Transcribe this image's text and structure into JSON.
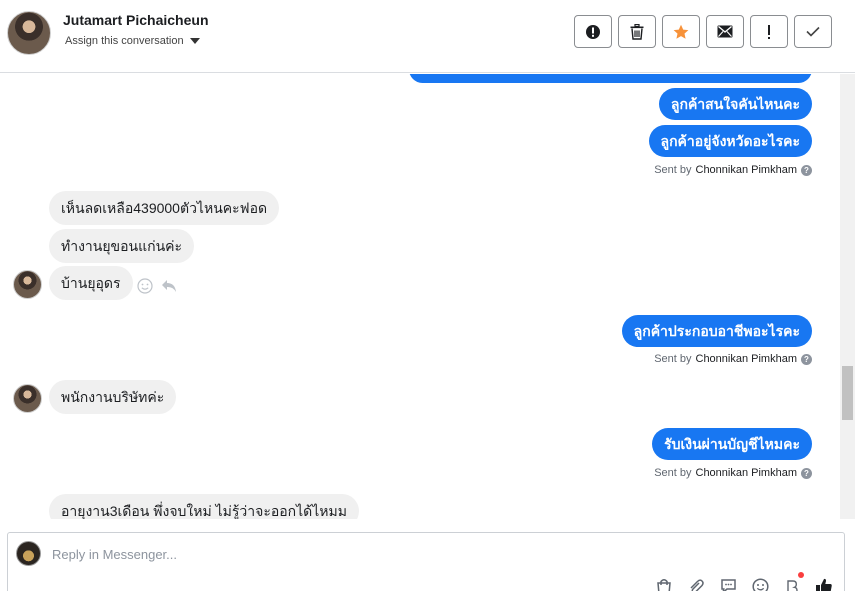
{
  "header": {
    "contact_name": "Jutamart Pichaicheun",
    "assign_label": "Assign this conversation",
    "actions": [
      {
        "icon": "alert-circle-icon"
      },
      {
        "icon": "trash-icon"
      },
      {
        "icon": "star-icon",
        "color": "#f7923a"
      },
      {
        "icon": "envelope-icon"
      },
      {
        "icon": "exclamation-icon"
      },
      {
        "icon": "check-icon"
      }
    ]
  },
  "messages": [
    {
      "direction": "out",
      "text": "ลูกค้าสนใจคันไหนคะ"
    },
    {
      "direction": "out",
      "text": "ลูกค้าอยู่จังหวัดอะไรคะ"
    },
    {
      "sent_by_prefix": "Sent by",
      "sent_by_name": "Chonnikan Pimkham"
    },
    {
      "direction": "in",
      "text": "เห็นลดเหลือ439000ตัวไหนคะฟอด"
    },
    {
      "direction": "in",
      "text": "ทำงานยุขอนแก่นค่ะ"
    },
    {
      "direction": "in",
      "text": "บ้านยุอุดร"
    },
    {
      "direction": "out",
      "text": "ลูกค้าประกอบอาชีพอะไรคะ"
    },
    {
      "sent_by_prefix": "Sent by",
      "sent_by_name": "Chonnikan Pimkham"
    },
    {
      "direction": "in",
      "text": "พนักงานบริษัทค่ะ"
    },
    {
      "direction": "out",
      "text": "รับเงินผ่านบัญชีไหมคะ"
    },
    {
      "sent_by_prefix": "Sent by",
      "sent_by_name": "Chonnikan Pimkham"
    },
    {
      "direction": "in",
      "text": "อายุงาน3เดือน พึ่งจบใหม่ ไม่รู้ว่าจะออกได้ไหมม"
    }
  ],
  "composer": {
    "placeholder": "Reply in Messenger...",
    "tools": [
      "bag-icon",
      "paperclip-icon",
      "chat-bubble-icon",
      "emoji-icon",
      "b-badge-icon",
      "thumbs-up-icon"
    ]
  },
  "colors": {
    "outgoing_bubble": "#1877f2",
    "incoming_bubble": "#f0f0f0",
    "notification_dot": "#fa3e3e"
  }
}
